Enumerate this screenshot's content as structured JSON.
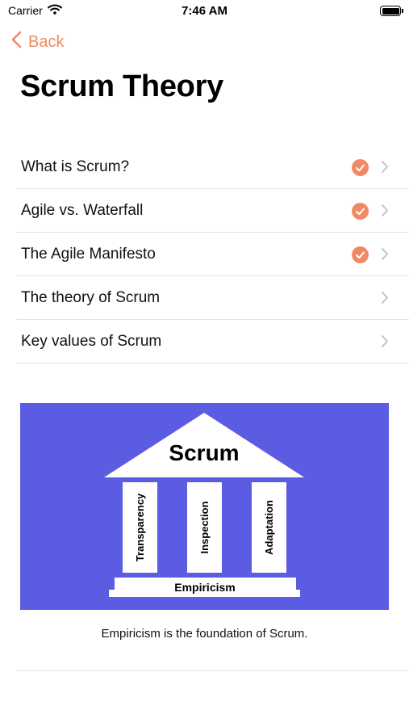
{
  "status_bar": {
    "carrier": "Carrier",
    "time": "7:46 AM"
  },
  "nav": {
    "back_label": "Back",
    "title": "Scrum Theory"
  },
  "topics": [
    {
      "label": "What is Scrum?",
      "completed": true
    },
    {
      "label": "Agile vs. Waterfall",
      "completed": true
    },
    {
      "label": "The Agile Manifesto",
      "completed": true
    },
    {
      "label": "The theory of Scrum",
      "completed": false
    },
    {
      "label": "Key values of Scrum",
      "completed": false
    }
  ],
  "figure": {
    "roof_label": "Scrum",
    "pillars": [
      "Transparency",
      "Inspection",
      "Adaptation"
    ],
    "base_label": "Empiricism",
    "caption": "Empiricism is the foundation of Scrum."
  },
  "colors": {
    "accent": "#f08a66",
    "figure_background": "#5b5ce2",
    "chevron": "#c4c4c7",
    "divider": "#e3e3e6"
  }
}
